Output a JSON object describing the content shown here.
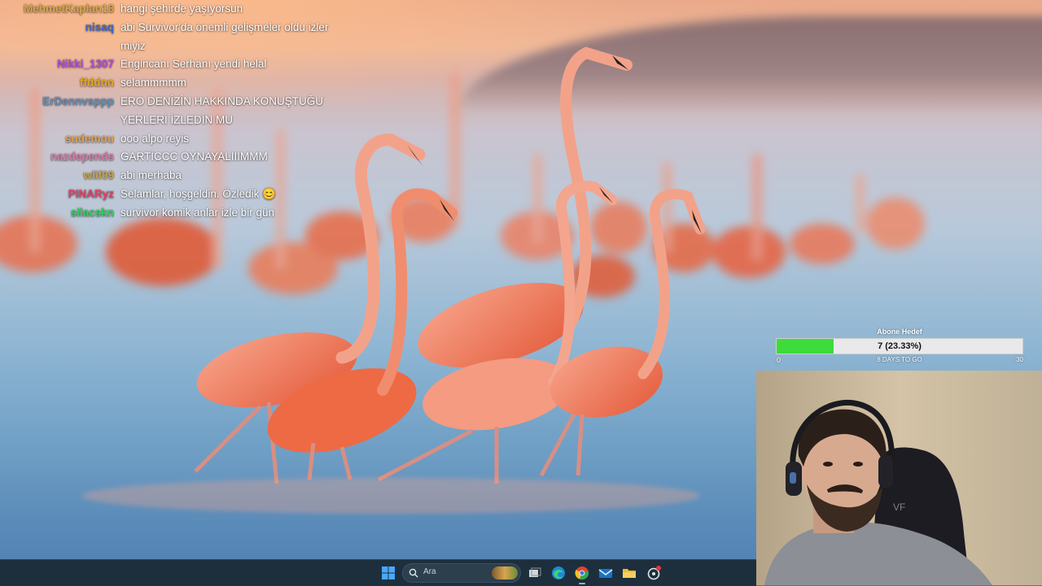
{
  "chat": {
    "messages": [
      {
        "user": "MehmetKaplan18",
        "color": "#d6a64a",
        "text": "hangi şehirde yaşıyorsun"
      },
      {
        "user": "nisaq",
        "color": "#3f69c9",
        "text": "abi Survivor'da önemli gelişmeler oldu izler miyiz"
      },
      {
        "user": "Nikki_1307",
        "color": "#b04dd6",
        "text": "Engincanı Serhanı yendi helal"
      },
      {
        "user": "ffddnn",
        "color": "#e8a818",
        "text": "selammmmm"
      },
      {
        "user": "ErDennvsppp",
        "color": "#5d8fb8",
        "text": "ERO DENİZİN HAKKINDA KONUŞTUĞU YERLERİ İZLEDİN MU"
      },
      {
        "user": "sudemou",
        "color": "#e3a14f",
        "text": "ooo alpo reyis"
      },
      {
        "user": "nazdepends",
        "color": "#d97aa6",
        "text": "GARTİCCC OYNAYALIIIMMM"
      },
      {
        "user": "wlif09",
        "color": "#c7a54a",
        "text": "abi merhaba"
      },
      {
        "user": "PINARyz",
        "color": "#e0436a",
        "text": "Selamlar, hoşgeldin. Özledik 😊"
      },
      {
        "user": "silacskn",
        "color": "#2fd15a",
        "text": "survivor komik anlar izle bir gün"
      }
    ]
  },
  "goal": {
    "title": "Abone Hedef",
    "progress_text": "7 (23.33%)",
    "progress": 0.2333,
    "min": "0",
    "max": "30",
    "days": "8 DAYS TO GO"
  },
  "taskbar": {
    "search_placeholder": "Ara",
    "icons": [
      "windows-start-icon",
      "search-icon",
      "task-view-icon",
      "edge-browser-icon",
      "chrome-icon",
      "mail-icon",
      "file-explorer-icon",
      "app-icon"
    ]
  },
  "colors": {
    "taskbar_bg": "#1d2f3d",
    "goal_fill": "#3ddc3a"
  }
}
